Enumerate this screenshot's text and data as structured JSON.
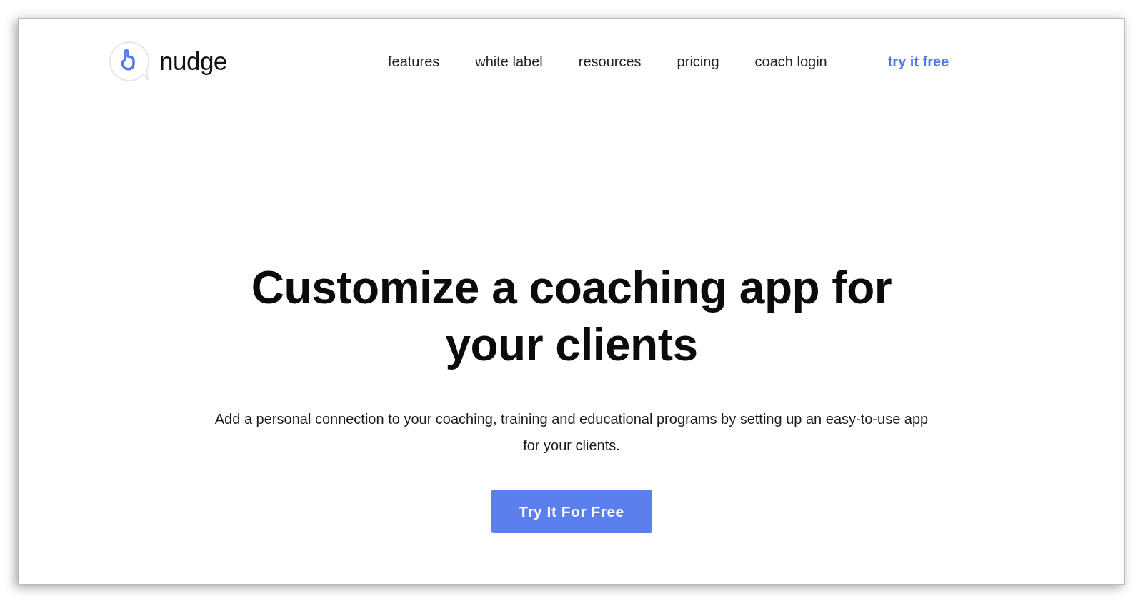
{
  "logo": {
    "name": "nudge"
  },
  "nav": [
    {
      "label": "features",
      "kind": "link"
    },
    {
      "label": "white label",
      "kind": "link"
    },
    {
      "label": "resources",
      "kind": "link"
    },
    {
      "label": "pricing",
      "kind": "link"
    },
    {
      "label": "coach login",
      "kind": "link"
    },
    {
      "label": "try it free",
      "kind": "cta"
    }
  ],
  "hero": {
    "heading": "Customize a coaching app for your clients",
    "description": "Add a personal connection to your coaching, training and educational programs by setting up an easy-to-use app for your clients.",
    "button": "Try It For Free"
  }
}
